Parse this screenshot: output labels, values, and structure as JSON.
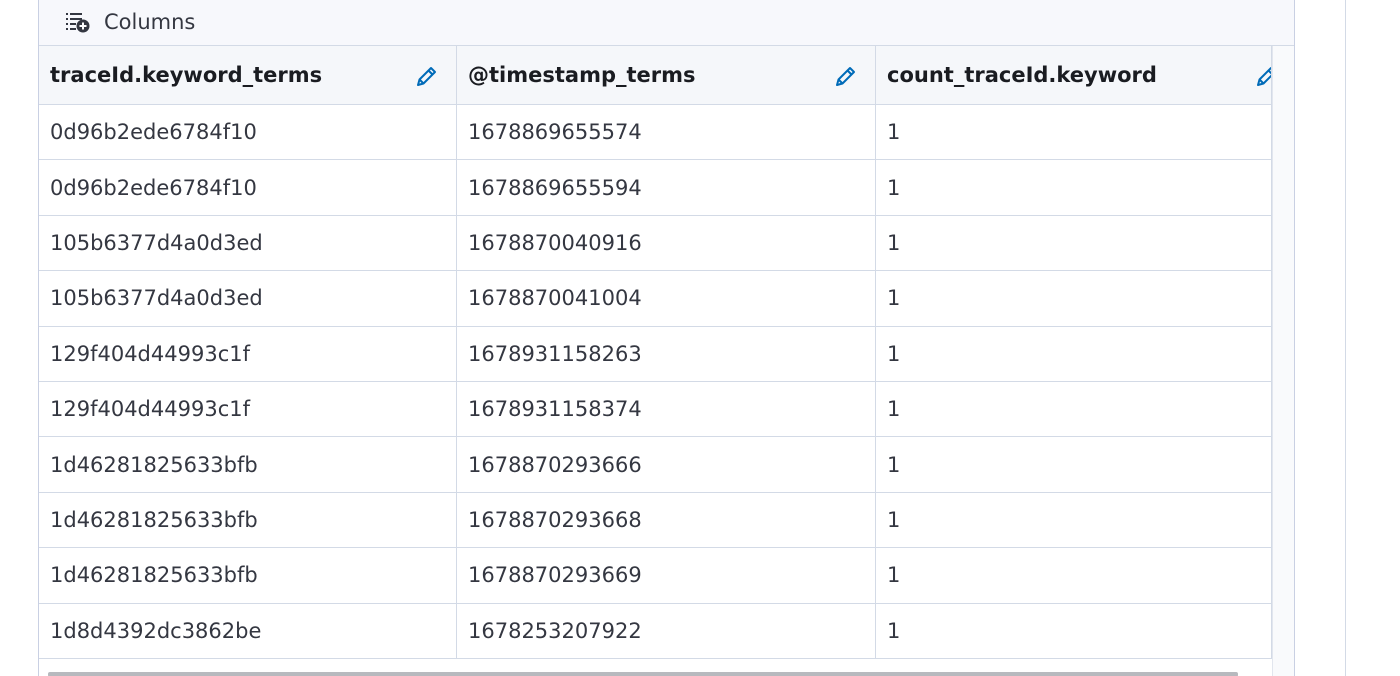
{
  "toolbar": {
    "columns_label": "Columns",
    "columns_icon": "columns-plus-icon"
  },
  "table": {
    "headers": [
      "traceId.keyword_terms",
      "@timestamp_terms",
      "count_traceId.keyword"
    ],
    "rows": [
      [
        "0d96b2ede6784f10",
        "1678869655574",
        "1"
      ],
      [
        "0d96b2ede6784f10",
        "1678869655594",
        "1"
      ],
      [
        "105b6377d4a0d3ed",
        "1678870040916",
        "1"
      ],
      [
        "105b6377d4a0d3ed",
        "1678870041004",
        "1"
      ],
      [
        "129f404d44993c1f",
        "1678931158263",
        "1"
      ],
      [
        "129f404d44993c1f",
        "1678931158374",
        "1"
      ],
      [
        "1d46281825633bfb",
        "1678870293666",
        "1"
      ],
      [
        "1d46281825633bfb",
        "1678870293668",
        "1"
      ],
      [
        "1d46281825633bfb",
        "1678870293669",
        "1"
      ],
      [
        "1d8d4392dc3862be",
        "1678253207922",
        "1"
      ]
    ]
  },
  "colors": {
    "accent": "#006bb8",
    "border": "#d3dae6",
    "header_bg": "#f5f7fa"
  }
}
